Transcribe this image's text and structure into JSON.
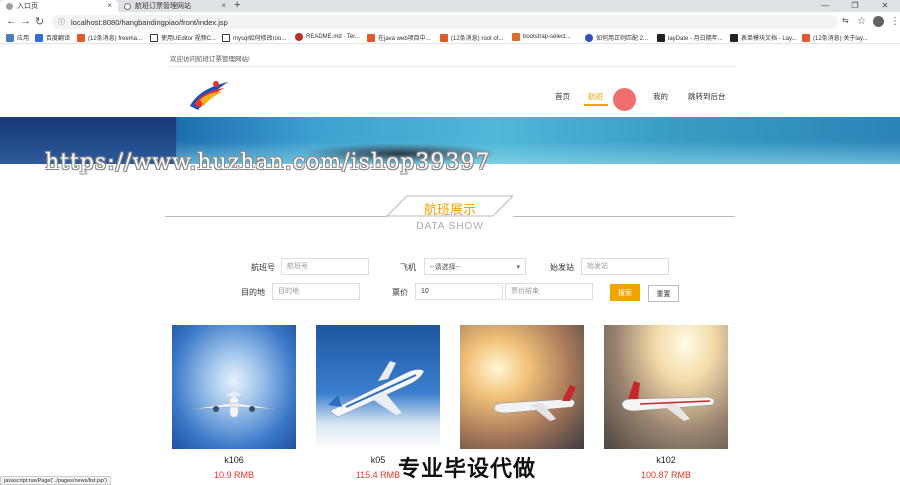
{
  "browser": {
    "tabs": [
      {
        "title": "入口页",
        "active": true
      },
      {
        "title": "航班订票管理网站",
        "active": false
      }
    ],
    "url": "localhost:8080/hangbandingpiao/front/index.jsp",
    "bookmarks": [
      {
        "label": "应用",
        "color": "#4a7cc2"
      },
      {
        "label": "百度翻译",
        "color": "#2f6fd8"
      },
      {
        "label": "(12条消息) freema...",
        "color": "#e05a2b"
      },
      {
        "label": "使用UEditor 视频C...",
        "color": "#333333"
      },
      {
        "label": "mysql如何修改roo...",
        "color": "#333333"
      },
      {
        "label": "README.md · Ter...",
        "color": "#c42c2c"
      },
      {
        "label": "在java web项目中...",
        "color": "#e05a2b"
      },
      {
        "label": "(12条消息) root of...",
        "color": "#e05a2b"
      },
      {
        "label": "bootstrap-select...",
        "color": "#e06a2b"
      },
      {
        "label": "如何用正则匹配 2...",
        "color": "#2b4fc2"
      },
      {
        "label": "layDate - 月日期年...",
        "color": "#222222"
      },
      {
        "label": "表单模块文档 - Lay...",
        "color": "#222222"
      },
      {
        "label": "(12条消息) 关于lay...",
        "color": "#e05a2b"
      }
    ]
  },
  "site": {
    "welcome": "欢迎访问航班订票管理网站!",
    "nav": [
      {
        "label": "首页",
        "active": false
      },
      {
        "label": "航班",
        "active": true
      },
      {
        "label": "我的",
        "active": false
      },
      {
        "label": "跳转到后台",
        "active": false
      }
    ],
    "watermark": "https://www.huzhan.com/ishop39397",
    "section_title": "航班展示",
    "section_subtitle": "DATA SHOW"
  },
  "search": {
    "flight_no_label": "航班号",
    "flight_no_placeholder": "航班号",
    "plane_label": "飞机",
    "plane_selected": "--请选择--",
    "origin_label": "始发站",
    "origin_placeholder": "始发站",
    "destination_label": "目的地",
    "destination_placeholder": "目的地",
    "price_label": "票价",
    "price_min_value": "10",
    "price_max_placeholder": "票价结束",
    "search_button": "搜索",
    "reset_button": "重置"
  },
  "flights": [
    {
      "name": "k106",
      "price": "10.9 RMB"
    },
    {
      "name": "k05",
      "price": "115.4 RMB"
    },
    {
      "name": "",
      "price": ""
    },
    {
      "name": "k102",
      "price": "100.87 RMB"
    }
  ],
  "overlay_text": "专业毕设代做",
  "status_bar": "javascript:navPage('../pages/news/list.jsp')"
}
